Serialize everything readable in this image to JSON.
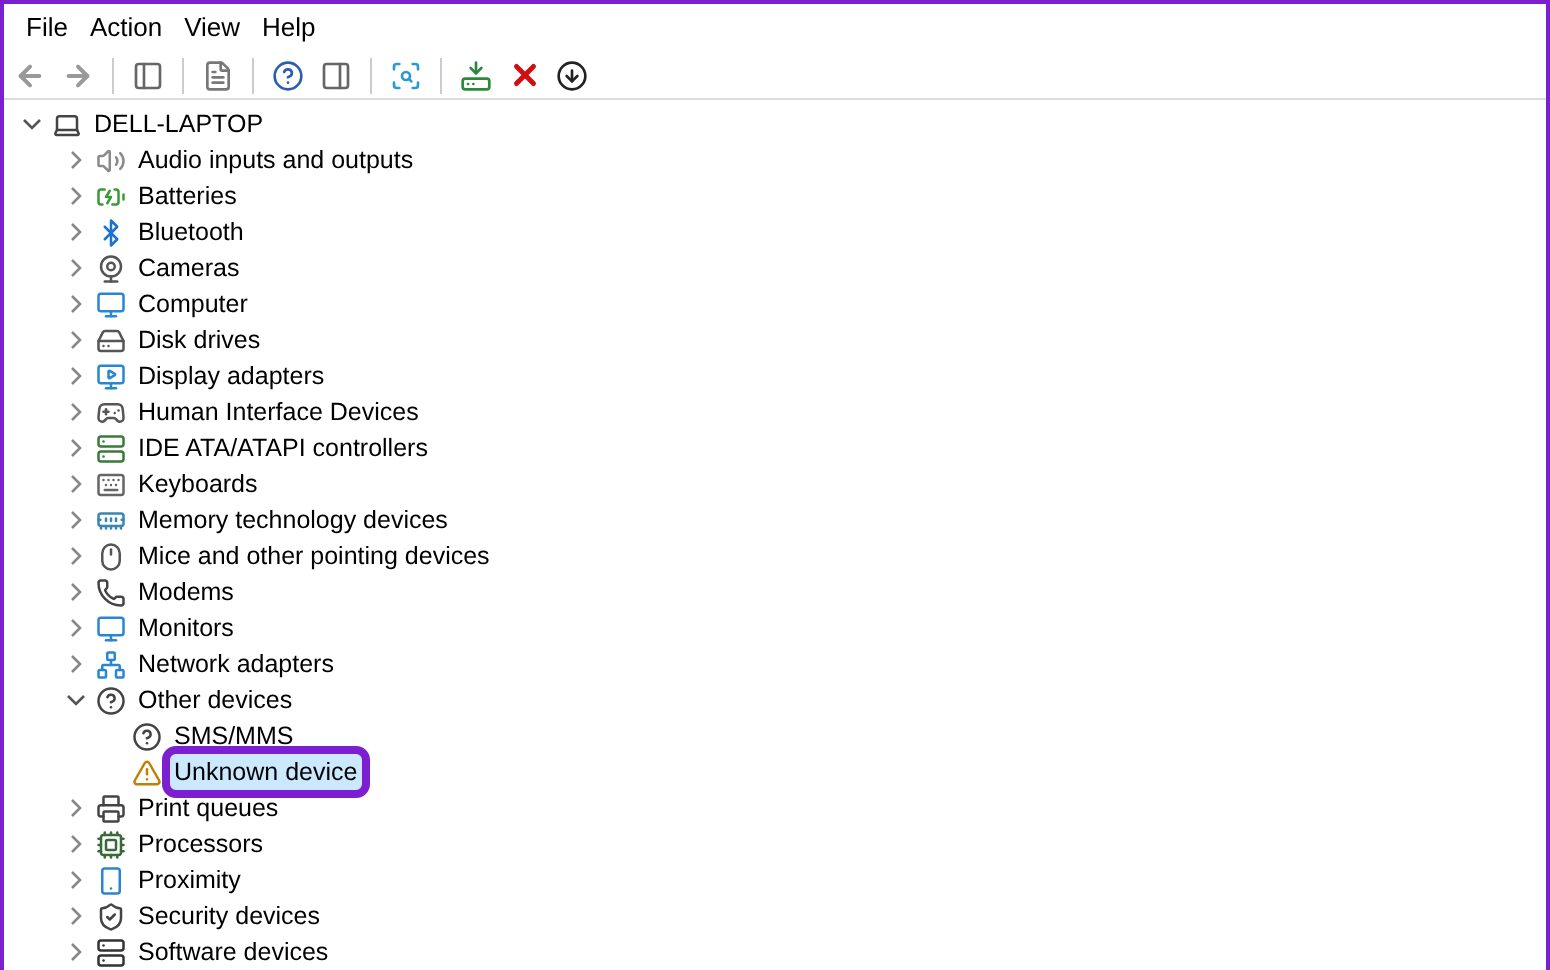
{
  "menu": [
    "File",
    "Action",
    "View",
    "Help"
  ],
  "tree": {
    "label": "DELL-LAPTOP",
    "expanded": true,
    "selected": false,
    "children": [
      {
        "label": "Audio inputs and outputs",
        "expanded": false,
        "selected": false
      },
      {
        "label": "Batteries",
        "expanded": false,
        "selected": false
      },
      {
        "label": "Bluetooth",
        "expanded": false,
        "selected": false
      },
      {
        "label": "Cameras",
        "expanded": false,
        "selected": false
      },
      {
        "label": "Computer",
        "expanded": false,
        "selected": false
      },
      {
        "label": "Disk drives",
        "expanded": false,
        "selected": false
      },
      {
        "label": "Display adapters",
        "expanded": false,
        "selected": false
      },
      {
        "label": "Human Interface Devices",
        "expanded": false,
        "selected": false
      },
      {
        "label": "IDE ATA/ATAPI controllers",
        "expanded": false,
        "selected": false
      },
      {
        "label": "Keyboards",
        "expanded": false,
        "selected": false
      },
      {
        "label": "Memory technology devices",
        "expanded": false,
        "selected": false
      },
      {
        "label": "Mice and other pointing devices",
        "expanded": false,
        "selected": false
      },
      {
        "label": "Modems",
        "expanded": false,
        "selected": false
      },
      {
        "label": "Monitors",
        "expanded": false,
        "selected": false
      },
      {
        "label": "Network adapters",
        "expanded": false,
        "selected": false
      },
      {
        "label": "Other devices",
        "expanded": true,
        "selected": false,
        "children": [
          {
            "label": "SMS/MMS",
            "selected": false
          },
          {
            "label": "Unknown device",
            "selected": true
          }
        ]
      },
      {
        "label": "Print queues",
        "expanded": false,
        "selected": false
      },
      {
        "label": "Processors",
        "expanded": false,
        "selected": false
      },
      {
        "label": "Proximity",
        "expanded": false,
        "selected": false
      },
      {
        "label": "Security devices",
        "expanded": false,
        "selected": false
      },
      {
        "label": "Software devices",
        "expanded": false,
        "selected": false
      }
    ]
  }
}
